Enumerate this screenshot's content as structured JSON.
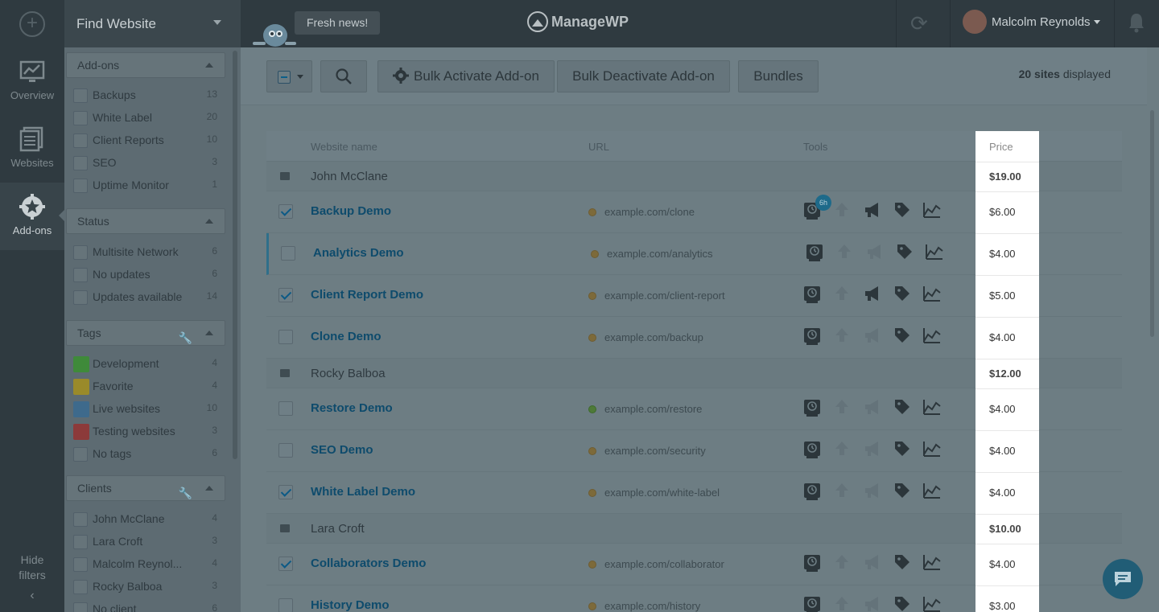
{
  "topbar": {
    "find_label": "Find Website",
    "news_label": "Fresh news!",
    "logo_text": "ManageWP",
    "user_name": "Malcolm Reynolds"
  },
  "nav": {
    "overview": "Overview",
    "websites": "Websites",
    "addons": "Add-ons",
    "hide_filters_line1": "Hide",
    "hide_filters_line2": "filters"
  },
  "filters": {
    "addons": {
      "title": "Add-ons",
      "items": [
        {
          "label": "Backups",
          "count": "13"
        },
        {
          "label": "White Label",
          "count": "20"
        },
        {
          "label": "Client Reports",
          "count": "10"
        },
        {
          "label": "SEO",
          "count": "3"
        },
        {
          "label": "Uptime Monitor",
          "count": "1"
        }
      ]
    },
    "status": {
      "title": "Status",
      "items": [
        {
          "label": "Multisite Network",
          "count": "6"
        },
        {
          "label": "No updates",
          "count": "6"
        },
        {
          "label": "Updates available",
          "count": "14"
        }
      ]
    },
    "tags": {
      "title": "Tags",
      "items": [
        {
          "label": "Development",
          "count": "4",
          "color": "#3f8a3a"
        },
        {
          "label": "Favorite",
          "count": "4",
          "color": "#9a8a2a"
        },
        {
          "label": "Live websites",
          "count": "10",
          "color": "#3e6a8c"
        },
        {
          "label": "Testing websites",
          "count": "3",
          "color": "#8c3a3a"
        },
        {
          "label": "No tags",
          "count": "6"
        }
      ]
    },
    "clients": {
      "title": "Clients",
      "items": [
        {
          "label": "John McClane",
          "count": "4"
        },
        {
          "label": "Lara Croft",
          "count": "3"
        },
        {
          "label": "Malcolm Reynol...",
          "count": "4"
        },
        {
          "label": "Rocky Balboa",
          "count": "3"
        },
        {
          "label": "No client",
          "count": "6"
        }
      ]
    }
  },
  "toolbar": {
    "bulk_activate": "Bulk Activate Add-on",
    "bulk_deactivate": "Bulk Deactivate Add-on",
    "bundles": "Bundles",
    "sites_count": "20 sites",
    "sites_suffix": " displayed"
  },
  "table": {
    "headers": {
      "name": "Website name",
      "url": "URL",
      "tools": "Tools",
      "price": "Price"
    },
    "rows": [
      {
        "type": "group",
        "name": "John McClane",
        "price": "$19.00"
      },
      {
        "type": "site",
        "name": "Backup Demo",
        "url": "example.com/clone",
        "checked": true,
        "price": "$6.00",
        "badge": "6h"
      },
      {
        "type": "site",
        "name": "Analytics Demo",
        "url": "example.com/analytics",
        "checked": false,
        "price": "$4.00"
      },
      {
        "type": "site",
        "name": "Client Report Demo",
        "url": "example.com/client-report",
        "checked": true,
        "price": "$5.00"
      },
      {
        "type": "site",
        "name": "Clone Demo",
        "url": "example.com/backup",
        "checked": false,
        "price": "$4.00"
      },
      {
        "type": "group",
        "name": "Rocky Balboa",
        "price": "$12.00"
      },
      {
        "type": "site",
        "name": "Restore Demo",
        "url": "example.com/restore",
        "checked": false,
        "price": "$4.00"
      },
      {
        "type": "site",
        "name": "SEO Demo",
        "url": "example.com/security",
        "checked": false,
        "price": "$4.00"
      },
      {
        "type": "site",
        "name": "White Label Demo",
        "url": "example.com/white-label",
        "checked": true,
        "price": "$4.00"
      },
      {
        "type": "group",
        "name": "Lara Croft",
        "price": "$10.00"
      },
      {
        "type": "site",
        "name": "Collaborators Demo",
        "url": "example.com/collaborator",
        "checked": true,
        "price": "$4.00"
      },
      {
        "type": "site",
        "name": "History Demo",
        "url": "example.com/history",
        "checked": false,
        "price": "$3.00"
      }
    ]
  }
}
